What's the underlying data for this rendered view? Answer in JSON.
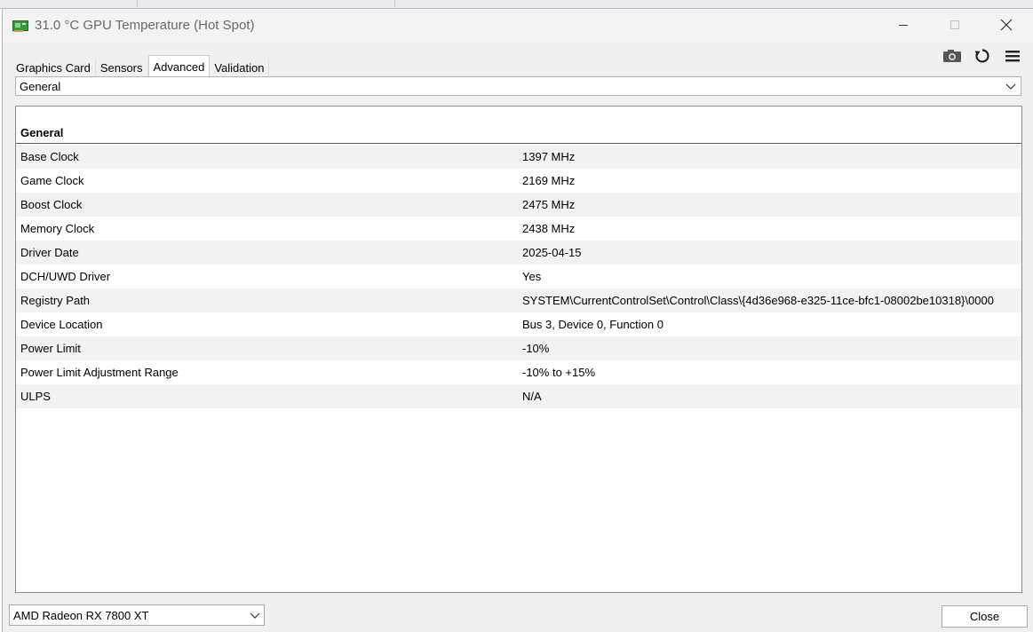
{
  "window": {
    "title": "31.0 °C GPU Temperature (Hot Spot)"
  },
  "tabs": [
    {
      "label": "Graphics Card",
      "active": false
    },
    {
      "label": "Sensors",
      "active": false
    },
    {
      "label": "Advanced",
      "active": true
    },
    {
      "label": "Validation",
      "active": false
    }
  ],
  "toolbar": {
    "icons": [
      "camera-icon",
      "refresh-icon",
      "menu-icon"
    ]
  },
  "category_select": {
    "value": "General"
  },
  "section": {
    "title": "General",
    "rows": [
      {
        "key": "Base Clock",
        "value": "1397 MHz"
      },
      {
        "key": "Game Clock",
        "value": "2169 MHz"
      },
      {
        "key": "Boost Clock",
        "value": "2475 MHz"
      },
      {
        "key": "Memory Clock",
        "value": "2438 MHz"
      },
      {
        "key": "Driver Date",
        "value": "2025-04-15"
      },
      {
        "key": "DCH/UWD Driver",
        "value": "Yes"
      },
      {
        "key": "Registry Path",
        "value": "SYSTEM\\CurrentControlSet\\Control\\Class\\{4d36e968-e325-11ce-bfc1-08002be10318}\\0000"
      },
      {
        "key": "Device Location",
        "value": "Bus 3, Device 0, Function 0"
      },
      {
        "key": "Power Limit",
        "value": "-10%"
      },
      {
        "key": "Power Limit Adjustment Range",
        "value": "-10% to +15%"
      },
      {
        "key": "ULPS",
        "value": "N/A"
      }
    ]
  },
  "gpu_select": {
    "value": "AMD Radeon RX 7800 XT"
  },
  "close_label": "Close",
  "colors": {
    "window_bg": "#f0f0f0",
    "panel_bg": "#ffffff",
    "alt_row": "#f2f2f2",
    "title_text": "#6b6b6b",
    "icon_green": "#3a9a3a"
  }
}
